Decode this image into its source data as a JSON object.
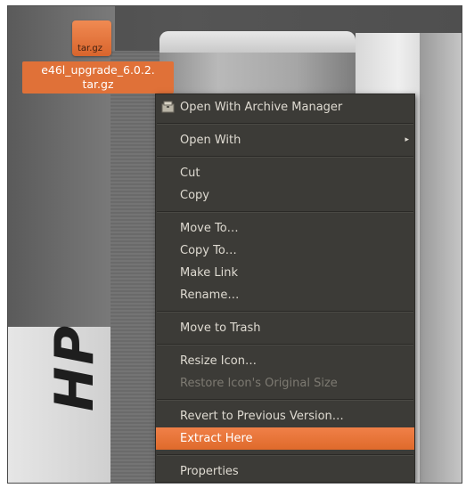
{
  "desktop": {
    "wallpaper_brand_text": "HP",
    "file": {
      "icon_tag": "tar.gz",
      "label_line1": "e46l_upgrade_6.0.2.",
      "label_line2": "tar.gz"
    }
  },
  "context_menu": {
    "items": [
      {
        "label": "Open With Archive Manager",
        "icon": "archive-manager-icon",
        "state": "normal"
      },
      {
        "label": "Open With",
        "has_submenu": true,
        "state": "normal"
      },
      {
        "label": "Cut",
        "state": "normal"
      },
      {
        "label": "Copy",
        "state": "normal"
      },
      {
        "label": "Move To…",
        "state": "normal"
      },
      {
        "label": "Copy To…",
        "state": "normal"
      },
      {
        "label": "Make Link",
        "state": "normal"
      },
      {
        "label": "Rename…",
        "state": "normal"
      },
      {
        "label": "Move to Trash",
        "state": "normal"
      },
      {
        "label": "Resize Icon…",
        "state": "normal"
      },
      {
        "label": "Restore Icon's Original Size",
        "state": "disabled"
      },
      {
        "label": "Revert to Previous Version…",
        "state": "normal"
      },
      {
        "label": "Extract Here",
        "state": "highlighted"
      },
      {
        "label": "Properties",
        "state": "normal"
      }
    ],
    "submenu_arrow": "▸"
  },
  "colors": {
    "menu_bg": "#3c3b37",
    "menu_text": "#dfdbd2",
    "highlight": "#e9743a",
    "selection_label": "#e07138"
  }
}
